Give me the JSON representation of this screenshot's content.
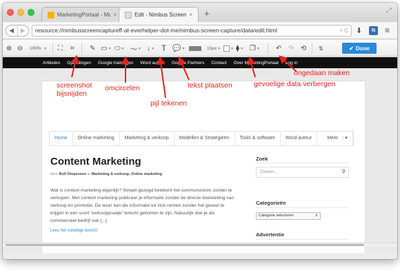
{
  "browser": {
    "tabs": [
      {
        "title": "MarketingPortaal - Market...",
        "close": "×"
      },
      {
        "title": "Edit - Nimbus Screen Capture",
        "close": "×"
      }
    ],
    "new_tab": "+",
    "url": "resource://nimbusscreencaptureff-at-everhelper-dot-me/nimbus-screen-capture/data/edit.html"
  },
  "toolbar": {
    "zoom": "100%",
    "size": "15px",
    "done_label": "Done"
  },
  "site": {
    "top_nav": [
      "Artikelen",
      "Opleidingen",
      "Google trainingen",
      "Word auteur",
      "Google Partners",
      "Contact",
      "Over MarketingPortaal",
      "Log in"
    ],
    "menu": [
      "Home",
      "Online marketing",
      "Marketing & verkoop",
      "Modellen & Strategieën",
      "Tools & software",
      "Word auteur",
      "Meer"
    ],
    "post": {
      "title": "Content Marketing",
      "meta_prefix": "door",
      "author": "Rolf Diepeveen",
      "meta_in": "in",
      "categories": "Marketing & verkoop, Online marketing",
      "body": "Wat is content marketing eigenlijk? Simpel gezegd betekent het communiceren zonder te verkopen. Met content marketing publiceer je informatie zonder de directe doelstelling van verkoop en promotie. De lezer kan die informatie tot zich nemen zonder het gevoel te krijgen in een soort 'verkooppraatje' terecht gekomen te zijn. Natuurlijk doe je als commercieel bedrijf ook [...]",
      "read_more": "Lees het volledige bericht"
    },
    "sidebar": {
      "search_title": "Zoek",
      "search_placeholder": "Zoeken...",
      "categories_title": "Categorieën",
      "categories_select": "Categorie selecteren",
      "ad_title": "Advertentie"
    }
  },
  "annotations": {
    "crop": "screenshot\nbijsnijden",
    "circle": "omcircelen",
    "arrow": "pijl tekenen",
    "text": "tekst plaatsen",
    "blur": "gevoelige data verbergen",
    "undo": "ongedaan maken"
  },
  "colors": {
    "annotation": "#e3241c",
    "done_button": "#2b89d8",
    "active_menu": "#2b89d8"
  }
}
